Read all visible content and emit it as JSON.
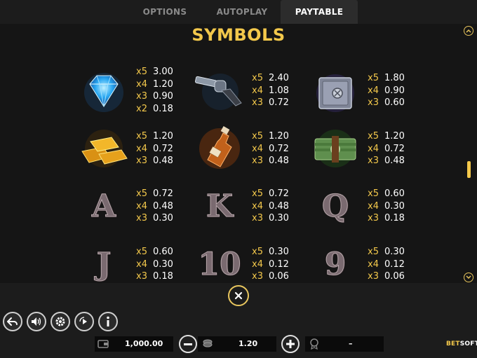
{
  "tabs": [
    {
      "label": "OPTIONS"
    },
    {
      "label": "AUTOPLAY"
    },
    {
      "label": "PAYTABLE"
    }
  ],
  "section_title": "SYMBOLS",
  "symbols": [
    {
      "icon": "diamond-icon",
      "pays": [
        [
          "x5",
          "3.00"
        ],
        [
          "x4",
          "1.20"
        ],
        [
          "x3",
          "0.90"
        ],
        [
          "x2",
          "0.18"
        ]
      ]
    },
    {
      "icon": "revolver-icon",
      "pays": [
        [
          "x5",
          "2.40"
        ],
        [
          "x4",
          "1.08"
        ],
        [
          "x3",
          "0.72"
        ]
      ]
    },
    {
      "icon": "safe-icon",
      "pays": [
        [
          "x5",
          "1.80"
        ],
        [
          "x4",
          "0.90"
        ],
        [
          "x3",
          "0.60"
        ]
      ]
    },
    {
      "icon": "gold-bars-icon",
      "pays": [
        [
          "x5",
          "1.20"
        ],
        [
          "x4",
          "0.72"
        ],
        [
          "x3",
          "0.48"
        ]
      ]
    },
    {
      "icon": "whiskey-bottle-icon",
      "pays": [
        [
          "x5",
          "1.20"
        ],
        [
          "x4",
          "0.72"
        ],
        [
          "x3",
          "0.48"
        ]
      ]
    },
    {
      "icon": "cash-stack-icon",
      "pays": [
        [
          "x5",
          "1.20"
        ],
        [
          "x4",
          "0.72"
        ],
        [
          "x3",
          "0.48"
        ]
      ]
    },
    {
      "icon": "letter-a-icon",
      "letter": "A",
      "pays": [
        [
          "x5",
          "0.72"
        ],
        [
          "x4",
          "0.48"
        ],
        [
          "x3",
          "0.30"
        ]
      ]
    },
    {
      "icon": "letter-k-icon",
      "letter": "K",
      "pays": [
        [
          "x5",
          "0.72"
        ],
        [
          "x4",
          "0.48"
        ],
        [
          "x3",
          "0.30"
        ]
      ]
    },
    {
      "icon": "letter-q-icon",
      "letter": "Q",
      "pays": [
        [
          "x5",
          "0.60"
        ],
        [
          "x4",
          "0.30"
        ],
        [
          "x3",
          "0.18"
        ]
      ]
    },
    {
      "icon": "letter-j-icon",
      "letter": "J",
      "pays": [
        [
          "x5",
          "0.60"
        ],
        [
          "x4",
          "0.30"
        ],
        [
          "x3",
          "0.18"
        ]
      ]
    },
    {
      "icon": "number-10-icon",
      "letter": "10",
      "pays": [
        [
          "x5",
          "0.30"
        ],
        [
          "x4",
          "0.12"
        ],
        [
          "x3",
          "0.06"
        ]
      ]
    },
    {
      "icon": "number-9-icon",
      "letter": "9",
      "pays": [
        [
          "x5",
          "0.30"
        ],
        [
          "x4",
          "0.12"
        ],
        [
          "x3",
          "0.06"
        ]
      ]
    }
  ],
  "balance": "1,000.00",
  "bet": "1.20",
  "win": "–",
  "brand": {
    "part1": "BET",
    "part2": "SOFT"
  },
  "colors": {
    "accent": "#f3c84b",
    "background": "#151515",
    "text": "#ffffff"
  }
}
